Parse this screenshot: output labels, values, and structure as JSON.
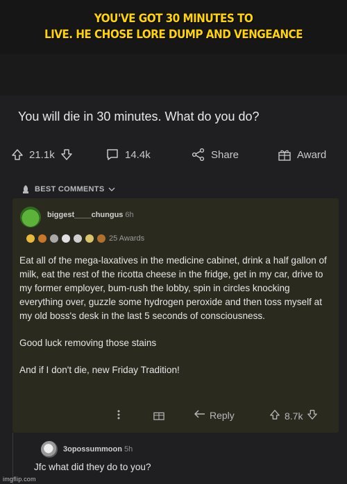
{
  "meme": {
    "caption_line1": "YOU'VE GOT 30 MINUTES TO",
    "caption_line2": "LIVE. HE CHOSE LORE DUMP AND VENGEANCE"
  },
  "post": {
    "title": "You will die in 30 minutes. What do you do?",
    "upvotes": "21.1k",
    "comments": "14.4k",
    "share_label": "Share",
    "award_label": "Award"
  },
  "sort": {
    "label": "BEST COMMENTS"
  },
  "comment": {
    "author": "biggest____chungus",
    "time": "6h",
    "awards_count": "25 Awards",
    "paragraphs": [
      "Eat all of the mega-laxatives in the medicine cabinet, drink a half gallon of milk, eat the rest of the ricotta cheese in the fridge, get in my car, drive to my former employer, bum-rush the lobby, spin in circles knocking everything over, guzzle some hydrogen peroxide and then toss myself at my old boss's desk in the last 5 seconds of consciousness.",
      "Good luck removing those stains",
      "And if I don't die, new Friday Tradition!"
    ],
    "reply_label": "Reply",
    "votes": "8.7k"
  },
  "reply": {
    "author": "3opossummoon",
    "time": "5h",
    "text": "Jfc what did they do to you?"
  },
  "watermark": "imgflip.com",
  "colors": {
    "caption": "#ffd400",
    "comment_bg": "#2b2a1f",
    "post_bg": "#1f1f22"
  }
}
